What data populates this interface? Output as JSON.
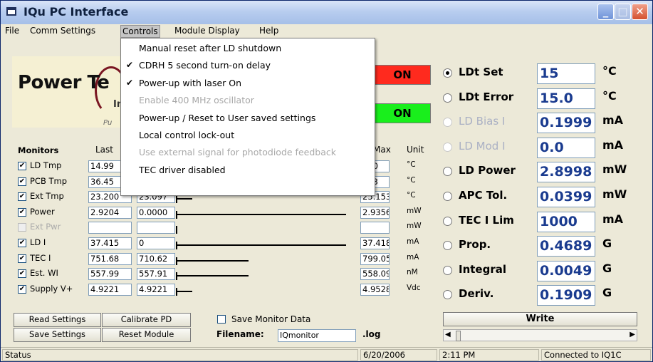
{
  "window": {
    "title": "IQu PC Interface",
    "minimize": "_",
    "maximize": "□",
    "close": "✕"
  },
  "menubar": [
    "File",
    "Comm Settings",
    "Controls",
    "Module Display",
    "Help"
  ],
  "controls_menu": [
    {
      "label": "Manual reset after LD shutdown",
      "checked": false,
      "enabled": true
    },
    {
      "label": "CDRH 5 second turn-on delay",
      "checked": true,
      "enabled": true
    },
    {
      "label": "Power-up with laser On",
      "checked": true,
      "enabled": true
    },
    {
      "label": "Enable 400 MHz oscillator",
      "checked": false,
      "enabled": false
    },
    {
      "label": "Power-up / Reset  to User saved settings",
      "checked": false,
      "enabled": true
    },
    {
      "label": "Local control lock-out",
      "checked": false,
      "enabled": true
    },
    {
      "label": "Use external signal for photodiode feedback",
      "checked": false,
      "enabled": false
    },
    {
      "label": "TEC driver disabled",
      "checked": false,
      "enabled": true
    }
  ],
  "logo": {
    "text": "Power Te",
    "sub": "In",
    "tag": "Pu"
  },
  "status_boxes": [
    "ON",
    "ON"
  ],
  "monitors": {
    "header": "Monitors",
    "col_last": "Last",
    "col_max": "Max",
    "col_unit": "Unit",
    "rows": [
      {
        "name": "LD Tmp",
        "checked": true,
        "enabled": true,
        "last": "14.99",
        "current": "",
        "max": "010",
        "unit": "°C",
        "level": 0
      },
      {
        "name": "PCB Tmp",
        "checked": true,
        "enabled": true,
        "last": "36.45",
        "current": "",
        "max": "453",
        "unit": "°C",
        "level": 0
      },
      {
        "name": "Ext Tmp",
        "checked": true,
        "enabled": true,
        "last": "23.200",
        "current": "23.097",
        "max": "25.153",
        "unit": "°C",
        "level": 0.09
      },
      {
        "name": "Power",
        "checked": true,
        "enabled": true,
        "last": "2.9204",
        "current": "0.0000",
        "max": "2.9356",
        "unit": "mW",
        "level": 0.94
      },
      {
        "name": "Ext Pwr",
        "checked": false,
        "enabled": false,
        "last": "",
        "current": "",
        "max": "",
        "unit": "mW",
        "level": 0
      },
      {
        "name": "LD I",
        "checked": true,
        "enabled": true,
        "last": "37.415",
        "current": "0",
        "max": "37.418",
        "unit": "mA",
        "level": 0.94
      },
      {
        "name": "TEC I",
        "checked": true,
        "enabled": true,
        "last": "751.68",
        "current": "710.62",
        "max": "799.05",
        "unit": "mA",
        "level": 0.4
      },
      {
        "name": "Est. WI",
        "checked": true,
        "enabled": true,
        "last": "557.99",
        "current": "557.91",
        "max": "558.09",
        "unit": "nM",
        "level": 0.4
      },
      {
        "name": "Supply V+",
        "checked": true,
        "enabled": true,
        "last": "4.9221",
        "current": "4.9221",
        "max": "4.9528",
        "unit": "Vdc",
        "level": 0.09
      }
    ]
  },
  "settings": [
    {
      "label": "LDt Set",
      "selected": true,
      "enabled": true,
      "value": "15",
      "unit": "°C"
    },
    {
      "label": "LDt Error",
      "selected": false,
      "enabled": true,
      "value": "15.0",
      "unit": "°C"
    },
    {
      "label": "LD Bias I",
      "selected": false,
      "enabled": false,
      "value": "0.1999",
      "unit": "mA"
    },
    {
      "label": "LD Mod I",
      "selected": false,
      "enabled": false,
      "value": "0.0",
      "unit": "mA"
    },
    {
      "label": "LD Power",
      "selected": false,
      "enabled": true,
      "value": "2.8998",
      "unit": "mW"
    },
    {
      "label": "APC Tol.",
      "selected": false,
      "enabled": true,
      "value": "0.0399",
      "unit": "mW"
    },
    {
      "label": "TEC I Lim",
      "selected": false,
      "enabled": true,
      "value": "1000",
      "unit": "mA"
    },
    {
      "label": "Prop.",
      "selected": false,
      "enabled": true,
      "value": "0.4689",
      "unit": "G"
    },
    {
      "label": "Integral",
      "selected": false,
      "enabled": true,
      "value": "0.0049",
      "unit": "G"
    },
    {
      "label": "Deriv.",
      "selected": false,
      "enabled": true,
      "value": "0.1909",
      "unit": "G"
    }
  ],
  "buttons": {
    "read_settings": "Read Settings",
    "calibrate_pd": "Calibrate PD",
    "save_settings": "Save Settings",
    "reset_module": "Reset Module",
    "write": "Write"
  },
  "save_monitor": {
    "label": "Save Monitor Data",
    "checked": false
  },
  "filename": {
    "label": "Filename:",
    "value": "IQmonitor",
    "ext": ".log"
  },
  "statusbar": {
    "status": "Status",
    "date": "6/20/2006",
    "time": "2:11 PM",
    "connection": "Connected to IQ1C"
  },
  "colors": {
    "status_red": "#ff2a1e",
    "status_green": "#19ef1c",
    "value_blue": "#1a3b8f"
  }
}
